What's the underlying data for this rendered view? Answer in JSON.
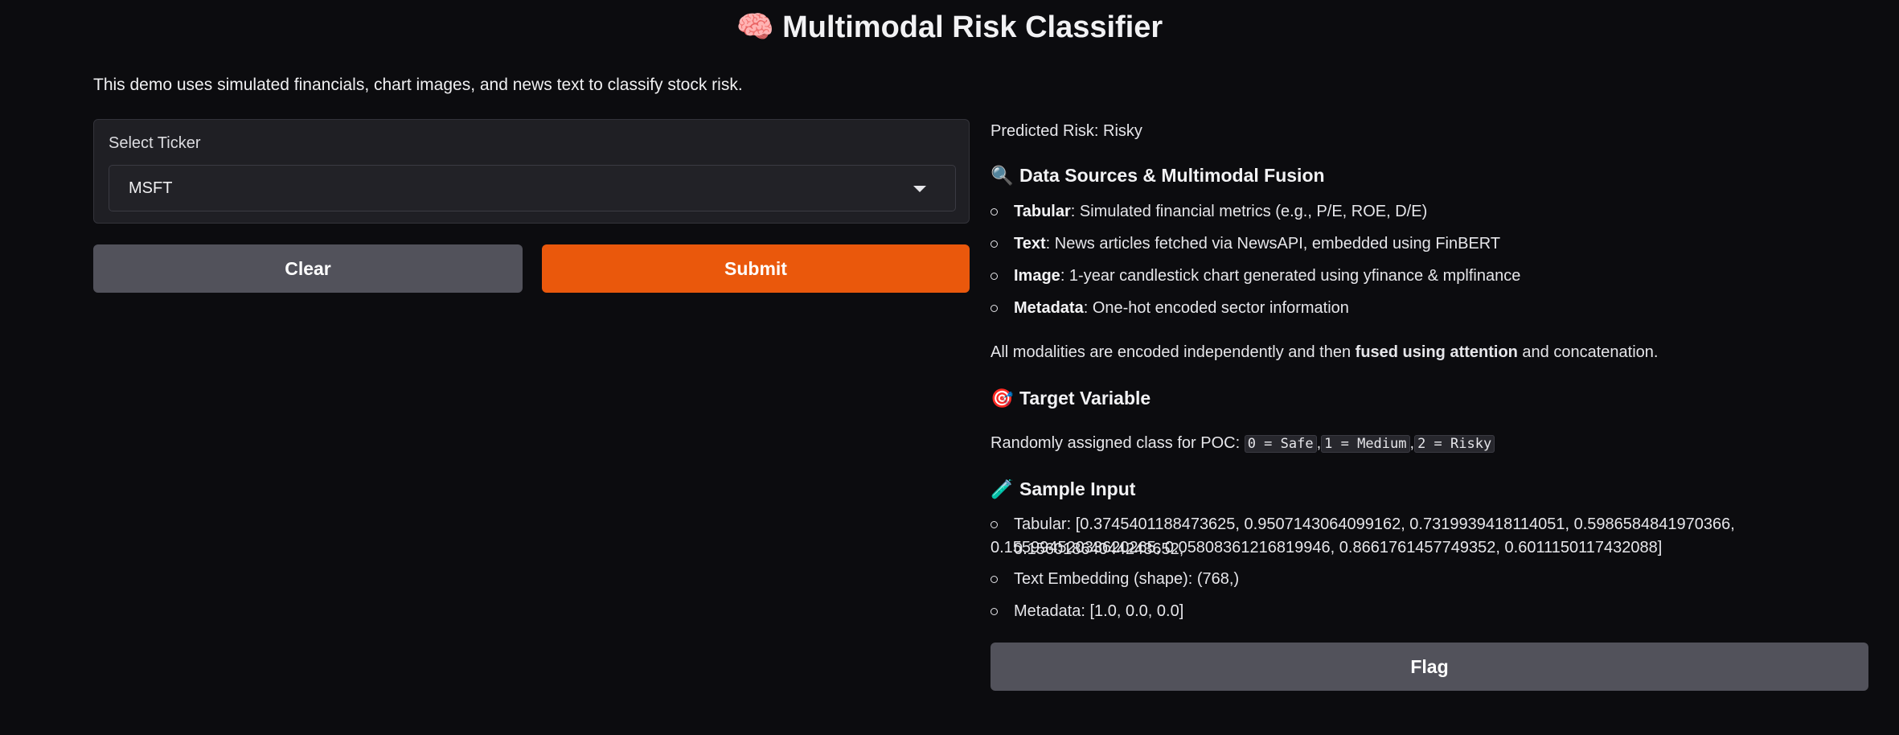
{
  "header": {
    "icon": "brain-icon",
    "emoji": "🧠",
    "title": "Multimodal Risk Classifier"
  },
  "description": "This demo uses simulated financials, chart images, and news text to classify stock risk.",
  "input": {
    "label": "Select Ticker",
    "value": "MSFT"
  },
  "buttons": {
    "clear": "Clear",
    "submit": "Submit",
    "flag": "Flag"
  },
  "colors": {
    "accent": "#ea580c",
    "secondary_button": "#52525b",
    "background": "#0c0c0f"
  },
  "output": {
    "prediction": "Predicted Risk: Risky",
    "section1": {
      "emoji": "🔍",
      "icon": "magnifier-icon",
      "title": "Data Sources & Multimodal Fusion",
      "items": [
        {
          "bold": "Tabular",
          "text": ": Simulated financial metrics (e.g., P/E, ROE, D/E)"
        },
        {
          "bold": "Text",
          "text": ": News articles fetched via NewsAPI, embedded using FinBERT"
        },
        {
          "bold": "Image",
          "text": ": 1-year candlestick chart generated using yfinance & mplfinance"
        },
        {
          "bold": "Metadata",
          "text": ": One-hot encoded sector information"
        }
      ],
      "fusion_pre": "All modalities are encoded independently and then ",
      "fusion_bold": "fused using attention",
      "fusion_post": " and concatenation."
    },
    "section2": {
      "emoji": "🎯",
      "icon": "target-icon",
      "title": "Target Variable",
      "pre": "Randomly assigned class for POC: ",
      "codes": [
        "0 = Safe",
        "1 = Medium",
        "2 = Risky"
      ]
    },
    "section3": {
      "emoji": "🧪",
      "icon": "test-tube-icon",
      "title": "Sample Input",
      "tabular_line1": "Tabular: [0.3745401188473625, 0.9507143064099162, 0.7319939418114051, 0.5986584841970366, 0.15601864044243652,",
      "tabular_line2": "0.15599452033620265, 0.05808361216819946, 0.8661761457749352, 0.6011150117432088]",
      "embedding": "Text Embedding (shape): (768,)",
      "metadata": "Metadata: [1.0, 0.0, 0.0]"
    }
  }
}
